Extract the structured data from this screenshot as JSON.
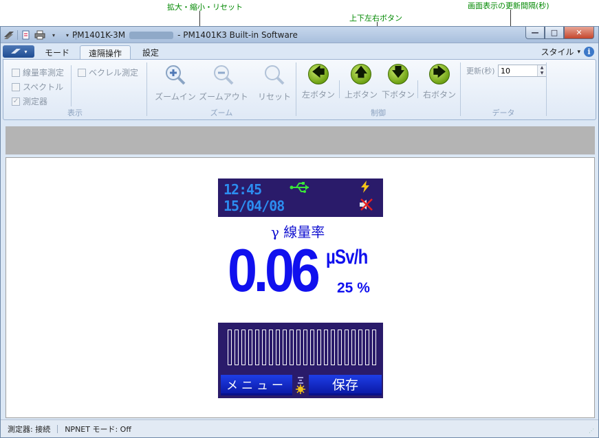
{
  "annotations": {
    "zoom_note": "拡大・縮小・リセット",
    "dpad_note": "上下左右ボタン",
    "interval_note": "画面表示の更新間隔(秒)"
  },
  "titlebar": {
    "device": "PM1401K-3M",
    "title": "- PM1401K3 Built-in Software",
    "minimize": "—",
    "maximize": "□",
    "close": "✕"
  },
  "tabs": {
    "mode": "モード",
    "remote": "遠隔操作",
    "settings": "設定",
    "style_menu": "スタイル",
    "style_arrow": "▾",
    "info": "i"
  },
  "ribbon": {
    "display": {
      "title": "表示",
      "dose_rate": "線量率測定",
      "becquerel": "ベクレル測定",
      "spectrum": "スペクトル",
      "meter": "測定器",
      "check_mark": "✓"
    },
    "zoom": {
      "title": "ズーム",
      "zoom_in": "ズームイン",
      "zoom_out": "ズームアウト",
      "reset": "リセット"
    },
    "control": {
      "title": "制御",
      "left": "左ボタン",
      "up": "上ボタン",
      "down": "下ボタン",
      "right": "右ボタン",
      "left_arrow": "🡄",
      "up_arrow": "🡅",
      "down_arrow": "🡇",
      "right_arrow": "🡆"
    },
    "data": {
      "title": "データ",
      "interval_label": "更新(秒)",
      "interval_value": "10",
      "spin_up": "▲",
      "spin_down": "▼"
    }
  },
  "device": {
    "time": "12:45",
    "date": "15/04/08",
    "label": "γ 線量率",
    "value": "0.06",
    "unit": "µSv/h",
    "percent": "25 %",
    "bar_count": 22,
    "softkey_left": "メニュー",
    "softkey_right": "保存"
  },
  "status": {
    "meter": "測定器: 接続",
    "npnet": "NPNET モード: Off"
  },
  "colors": {
    "device_bg": "#2a1b6a",
    "device_text": "#2c8df0",
    "dose_text": "#1010ee",
    "annotation_text": "#008800"
  }
}
